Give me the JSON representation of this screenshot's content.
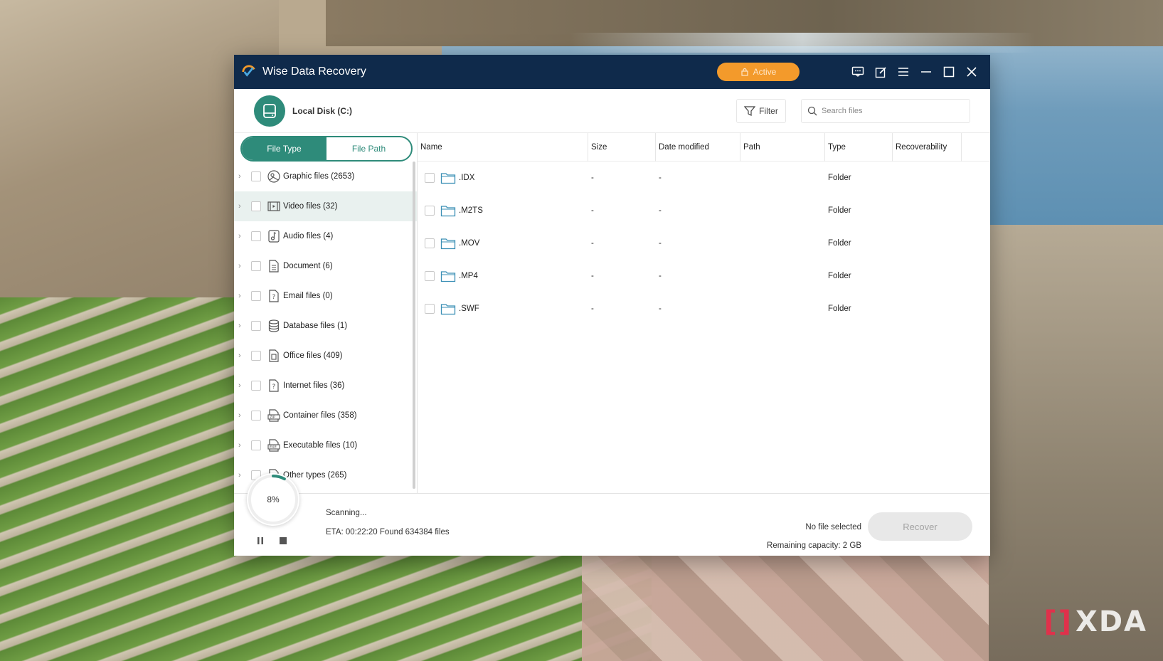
{
  "app": {
    "title": "Wise Data Recovery",
    "active_label": "Active",
    "accent_color": "#2e8b7a",
    "titlebar_color": "#0f2a4b",
    "active_color": "#f39a2b",
    "title_icons": [
      "feedback-icon",
      "edit-icon",
      "menu-icon",
      "minimize-icon",
      "maximize-icon",
      "close-icon"
    ]
  },
  "header": {
    "disk_label": "Local Disk (C:)",
    "filter_label": "Filter",
    "search_placeholder": "Search files"
  },
  "sidebar": {
    "tabs": [
      "File Type",
      "File Path"
    ],
    "active_tab": "File Type",
    "categories": [
      {
        "label": "Graphic files (2653)",
        "icon": "image-icon"
      },
      {
        "label": "Video files (32)",
        "icon": "video-icon",
        "selected": true
      },
      {
        "label": "Audio files (4)",
        "icon": "audio-icon"
      },
      {
        "label": "Document (6)",
        "icon": "document-icon"
      },
      {
        "label": "Email files (0)",
        "icon": "email-icon"
      },
      {
        "label": "Database files (1)",
        "icon": "database-icon"
      },
      {
        "label": "Office files (409)",
        "icon": "office-icon"
      },
      {
        "label": "Internet files (36)",
        "icon": "internet-icon"
      },
      {
        "label": "Container files (358)",
        "icon": "zip-icon"
      },
      {
        "label": "Executable files (10)",
        "icon": "exe-icon"
      },
      {
        "label": "Other types (265)",
        "icon": "other-icon"
      }
    ]
  },
  "table": {
    "columns": [
      "Name",
      "Size",
      "Date modified",
      "Path",
      "Type",
      "Recoverability"
    ],
    "rows": [
      {
        "name": ".IDX",
        "size": "-",
        "date": "-",
        "path": "",
        "type": "Folder",
        "recoverability": ""
      },
      {
        "name": ".M2TS",
        "size": "-",
        "date": "-",
        "path": "",
        "type": "Folder",
        "recoverability": ""
      },
      {
        "name": ".MOV",
        "size": "-",
        "date": "-",
        "path": "",
        "type": "Folder",
        "recoverability": ""
      },
      {
        "name": ".MP4",
        "size": "-",
        "date": "-",
        "path": "",
        "type": "Folder",
        "recoverability": ""
      },
      {
        "name": ".SWF",
        "size": "-",
        "date": "-",
        "path": "",
        "type": "Folder",
        "recoverability": ""
      }
    ]
  },
  "footer": {
    "progress_percent": 8,
    "progress_label": "8%",
    "status": "Scanning...",
    "eta": "ETA: 00:22:20 Found 634384 files",
    "selection": "No file selected",
    "capacity": "Remaining capacity: 2 GB",
    "recover_label": "Recover"
  },
  "watermark": "XDA"
}
